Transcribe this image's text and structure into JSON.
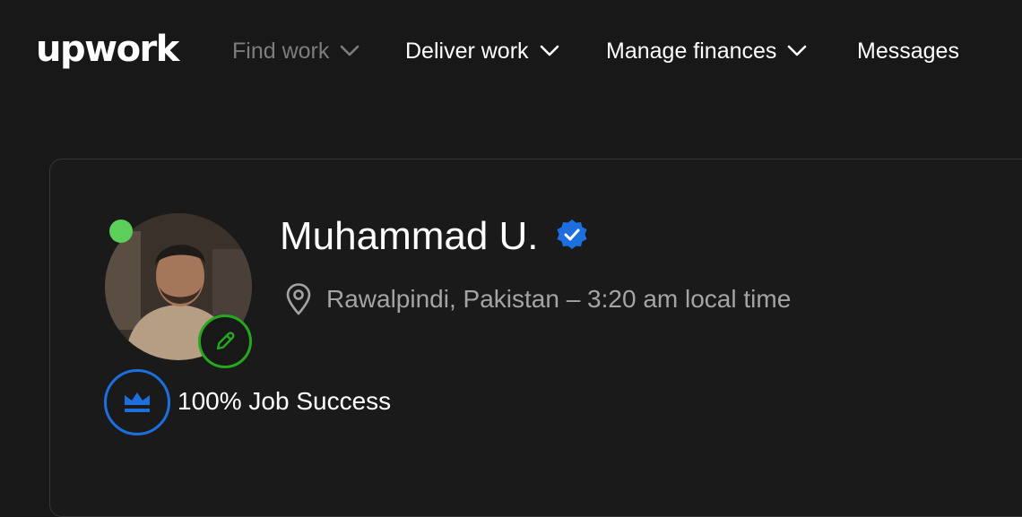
{
  "brand": {
    "logo_text": "upwork"
  },
  "nav": {
    "items": [
      {
        "label": "Find work",
        "has_dropdown": true,
        "state": "muted"
      },
      {
        "label": "Deliver work",
        "has_dropdown": true,
        "state": "normal"
      },
      {
        "label": "Manage finances",
        "has_dropdown": true,
        "state": "normal"
      },
      {
        "label": "Messages",
        "has_dropdown": false,
        "state": "normal"
      }
    ]
  },
  "profile": {
    "name": "Muhammad U.",
    "verified_icon": "verified-badge-icon",
    "location": "Rawalpindi, Pakistan – 3:20 am local time",
    "online": true,
    "job_success": "100% Job Success",
    "icons": {
      "location": "map-pin-icon",
      "edit": "pencil-icon",
      "job_success": "crown-icon"
    }
  },
  "colors": {
    "background": "#181818",
    "muted_text": "#7d7d7d",
    "secondary_text": "#a4a4a4",
    "online_green": "#5bcf5a",
    "edit_green": "#24a81e",
    "accent_blue": "#1d6fe0",
    "card_border": "#373737"
  }
}
